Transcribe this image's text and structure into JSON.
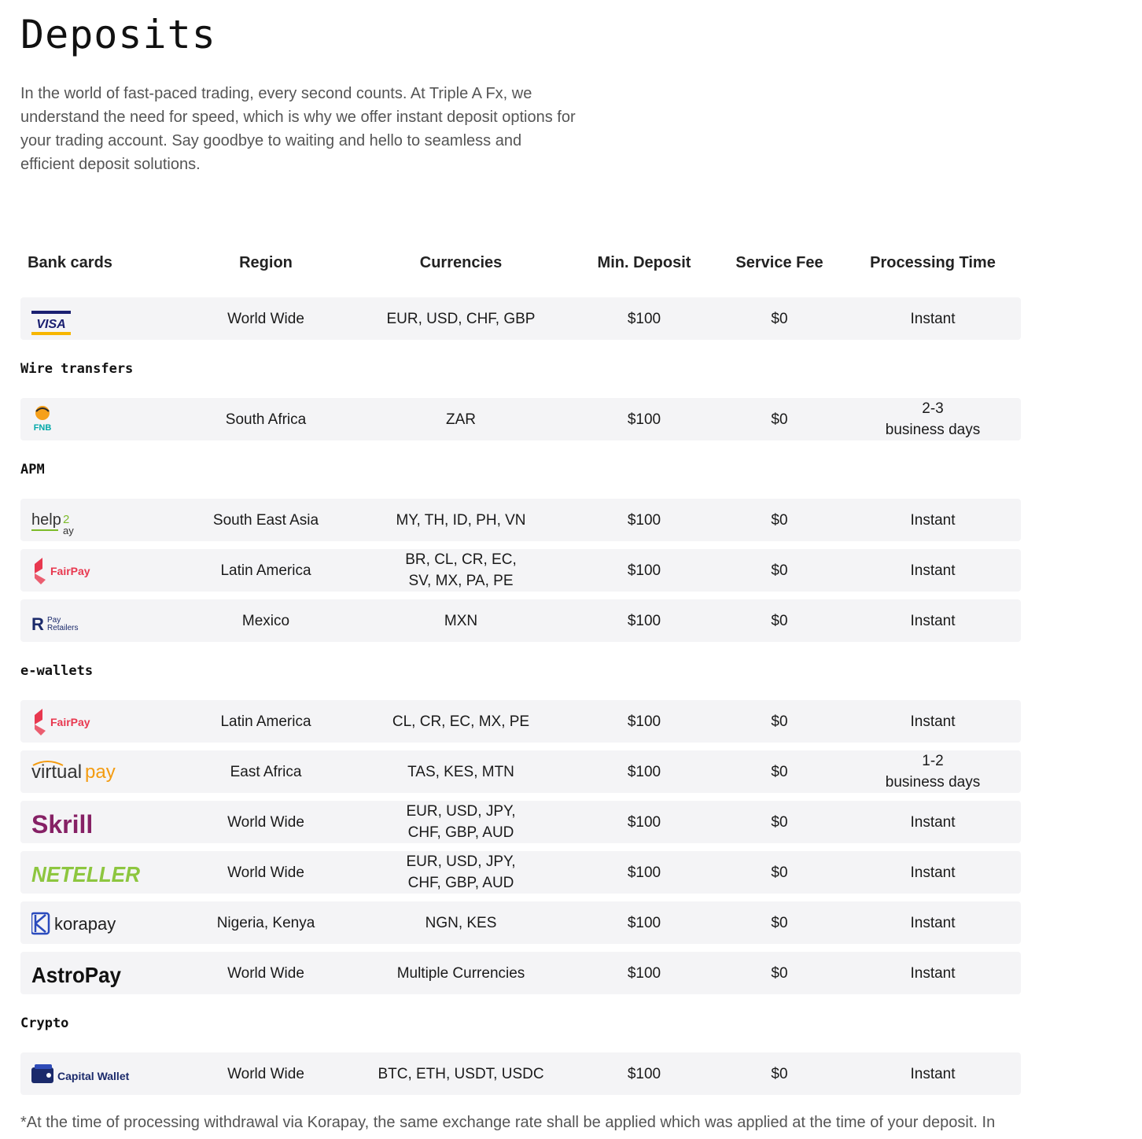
{
  "page": {
    "title": "Deposits",
    "intro": "In the world of fast-paced trading, every second counts. At Triple A Fx, we understand the need for speed, which is why we offer instant deposit options for your trading account. Say goodbye to waiting and hello to seamless and efficient deposit solutions."
  },
  "table_headers": [
    "Bank cards",
    "Region",
    "Currencies",
    "Min. Deposit",
    "Service Fee",
    "Processing Time"
  ],
  "sections": {
    "wire": "Wire transfers",
    "apm": "APM",
    "ewallets": "e-wallets",
    "crypto": "Crypto"
  },
  "rows": [
    {
      "logo": "VISA",
      "logo_icon": "visa-logo",
      "region": "World Wide",
      "currencies": "EUR, USD, CHF, GBP",
      "min": "$100",
      "fee": "$0",
      "time": "Instant"
    },
    {
      "logo": "FNB",
      "logo_icon": "fnb-logo",
      "region": "South Africa",
      "currencies": "ZAR",
      "min": "$100",
      "fee": "$0",
      "time": "2-3\nbusiness days"
    },
    {
      "logo": "help2pay",
      "logo_icon": "help2pay-logo",
      "region": "South East Asia",
      "currencies": "MY, TH, ID, PH, VN",
      "min": "$100",
      "fee": "$0",
      "time": "Instant"
    },
    {
      "logo": "FairPay",
      "logo_icon": "fairpay-logo",
      "region": "Latin America",
      "currencies": "BR, CL, CR, EC,\nSV, MX, PA, PE",
      "min": "$100",
      "fee": "$0",
      "time": "Instant"
    },
    {
      "logo": "Pay Retailers",
      "logo_icon": "payretailers-logo",
      "region": "Mexico",
      "currencies": "MXN",
      "min": "$100",
      "fee": "$0",
      "time": "Instant"
    },
    {
      "logo": "FairPay",
      "logo_icon": "fairpay-logo",
      "region": "Latin America",
      "currencies": "CL, CR, EC, MX, PE",
      "min": "$100",
      "fee": "$0",
      "time": "Instant"
    },
    {
      "logo": "virtualpay",
      "logo_icon": "virtualpay-logo",
      "region": "East Africa",
      "currencies": "TAS, KES, MTN",
      "min": "$100",
      "fee": "$0",
      "time": "1-2\nbusiness days"
    },
    {
      "logo": "Skrill",
      "logo_icon": "skrill-logo",
      "region": "World Wide",
      "currencies": "EUR, USD, JPY,\nCHF, GBP, AUD",
      "min": "$100",
      "fee": "$0",
      "time": "Instant"
    },
    {
      "logo": "NETELLER",
      "logo_icon": "neteller-logo",
      "region": "World Wide",
      "currencies": "EUR, USD, JPY,\nCHF, GBP, AUD",
      "min": "$100",
      "fee": "$0",
      "time": "Instant"
    },
    {
      "logo": "korapay",
      "logo_icon": "korapay-logo",
      "region": "Nigeria, Kenya",
      "currencies": "NGN, KES",
      "min": "$100",
      "fee": "$0",
      "time": "Instant"
    },
    {
      "logo": "AstroPay",
      "logo_icon": "astropay-logo",
      "region": "World Wide",
      "currencies": "Multiple Currencies",
      "min": "$100",
      "fee": "$0",
      "time": "Instant"
    },
    {
      "logo": "Capital Wallet",
      "logo_icon": "capital-wallet-logo",
      "region": "World Wide",
      "currencies": "BTC, ETH, USDT, USDC",
      "min": "$100",
      "fee": "$0",
      "time": "Instant"
    }
  ],
  "footnote": "*At the time of processing withdrawal via Korapay, the same exchange rate shall be applied which was applied at the time of your deposit. In",
  "colors": {
    "row_bg": "#f4f4f6",
    "visa_blue": "#1a1f71",
    "visa_gold": "#f7b600",
    "fairpay_red": "#e8384f",
    "skrill_purple": "#862165",
    "neteller_green": "#8dc63f",
    "virtualpay_orange": "#f39c12",
    "korapay_blue": "#2b4bbd"
  }
}
